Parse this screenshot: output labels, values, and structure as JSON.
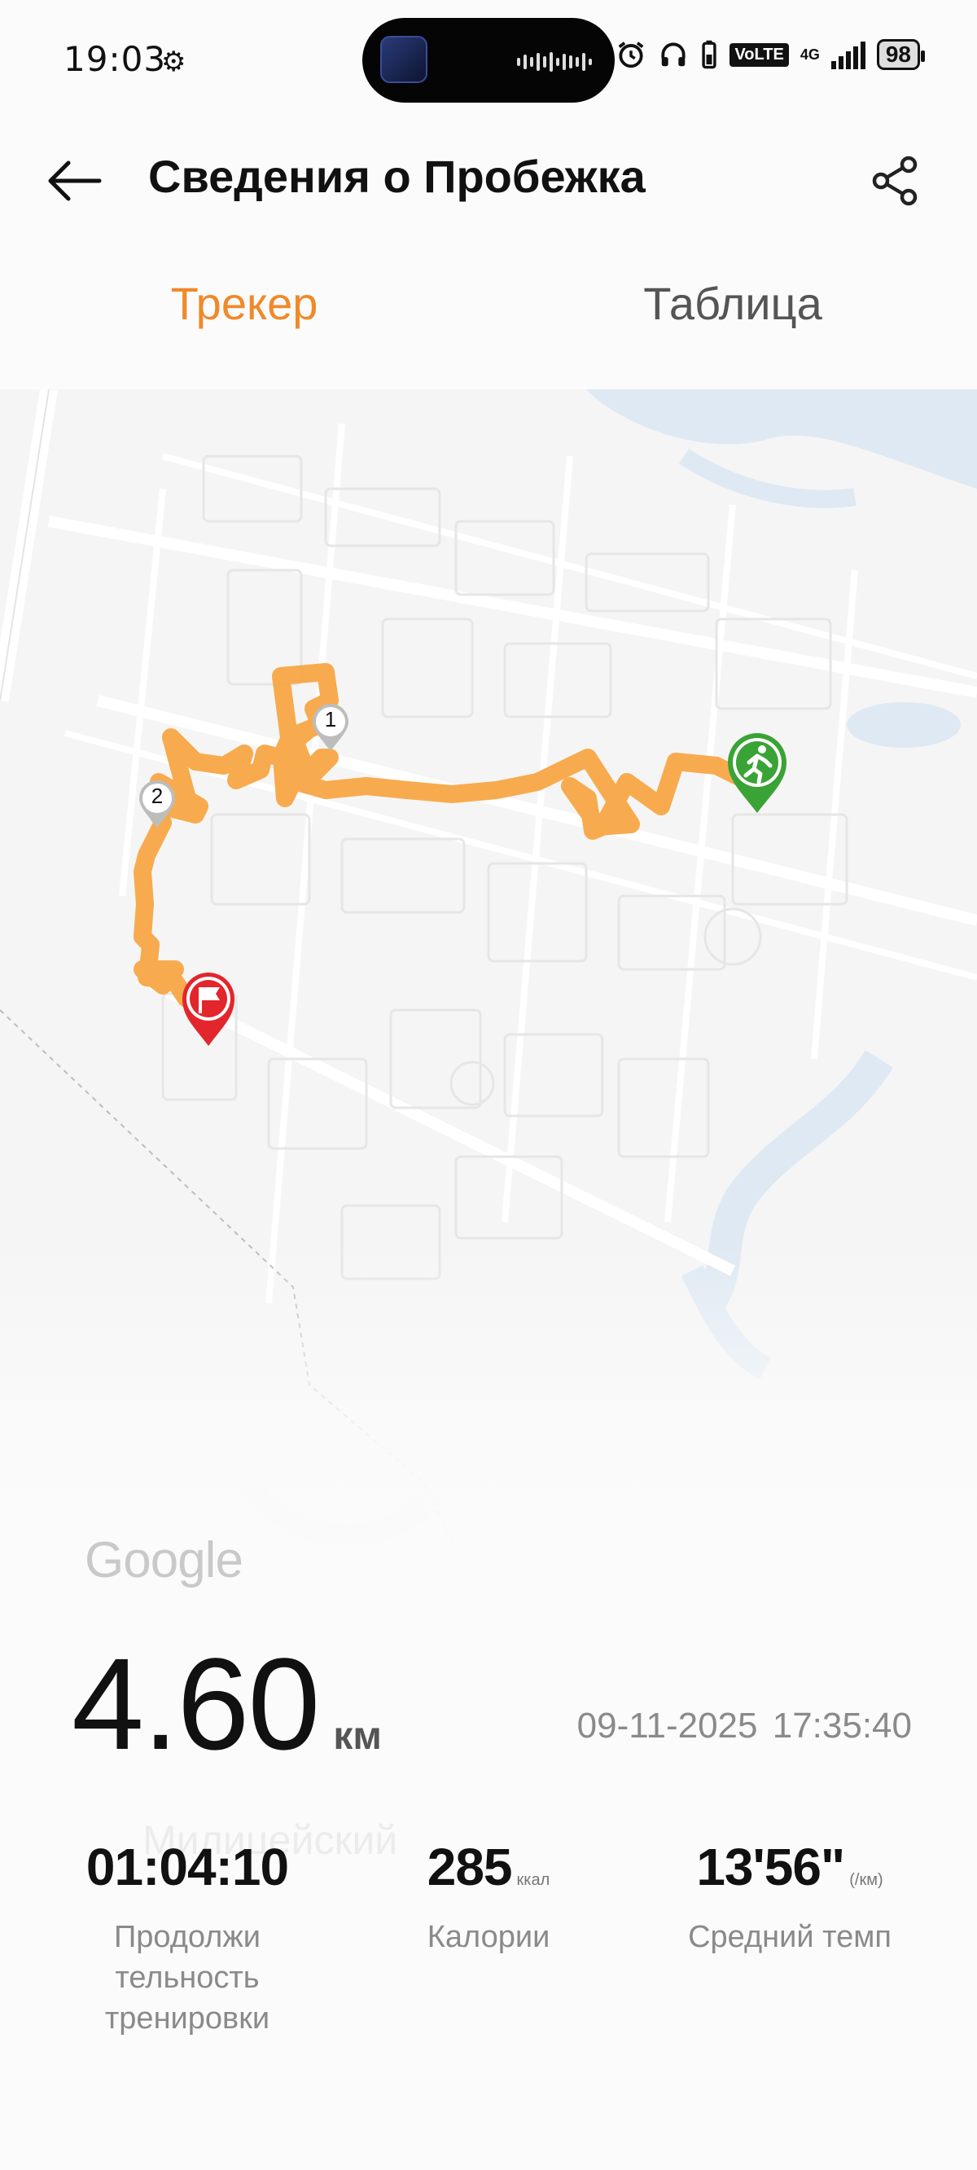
{
  "status": {
    "time": "19:03",
    "battery": "98",
    "volte": "VoLTE",
    "network": "4G",
    "icons": [
      "gear-icon",
      "alarm-icon",
      "headphones-icon",
      "battery-small-icon",
      "volte-icon",
      "signal-icon",
      "battery-icon"
    ]
  },
  "header": {
    "title": "Сведения о Пробежка",
    "back_icon": "back-arrow-icon",
    "share_icon": "share-icon"
  },
  "tabs": [
    {
      "label": "Трекер",
      "active": true
    },
    {
      "label": "Таблица",
      "active": false
    }
  ],
  "map": {
    "markers": [
      "1",
      "2"
    ],
    "start_icon": "runner-icon",
    "finish_icon": "flag-icon",
    "provider": "Google",
    "background_label": "Милицейский",
    "route_color": "#f7a744",
    "start_color": "#3aa335",
    "finish_color": "#e3262c"
  },
  "summary": {
    "distance": "4.60",
    "distance_unit": "км",
    "date": "09-11-2025",
    "time": "17:35:40"
  },
  "metrics": [
    {
      "value": "01:04:10",
      "unit": "",
      "label": "Продолжи тельность тренировки"
    },
    {
      "value": "285",
      "unit": "ккал",
      "label": "Калории"
    },
    {
      "value": "13'56\"",
      "unit": "(/км)",
      "label": "Средний темп"
    }
  ],
  "colors": {
    "accent": "#f0892a",
    "text": "#111111",
    "muted": "#8a8a8a"
  }
}
